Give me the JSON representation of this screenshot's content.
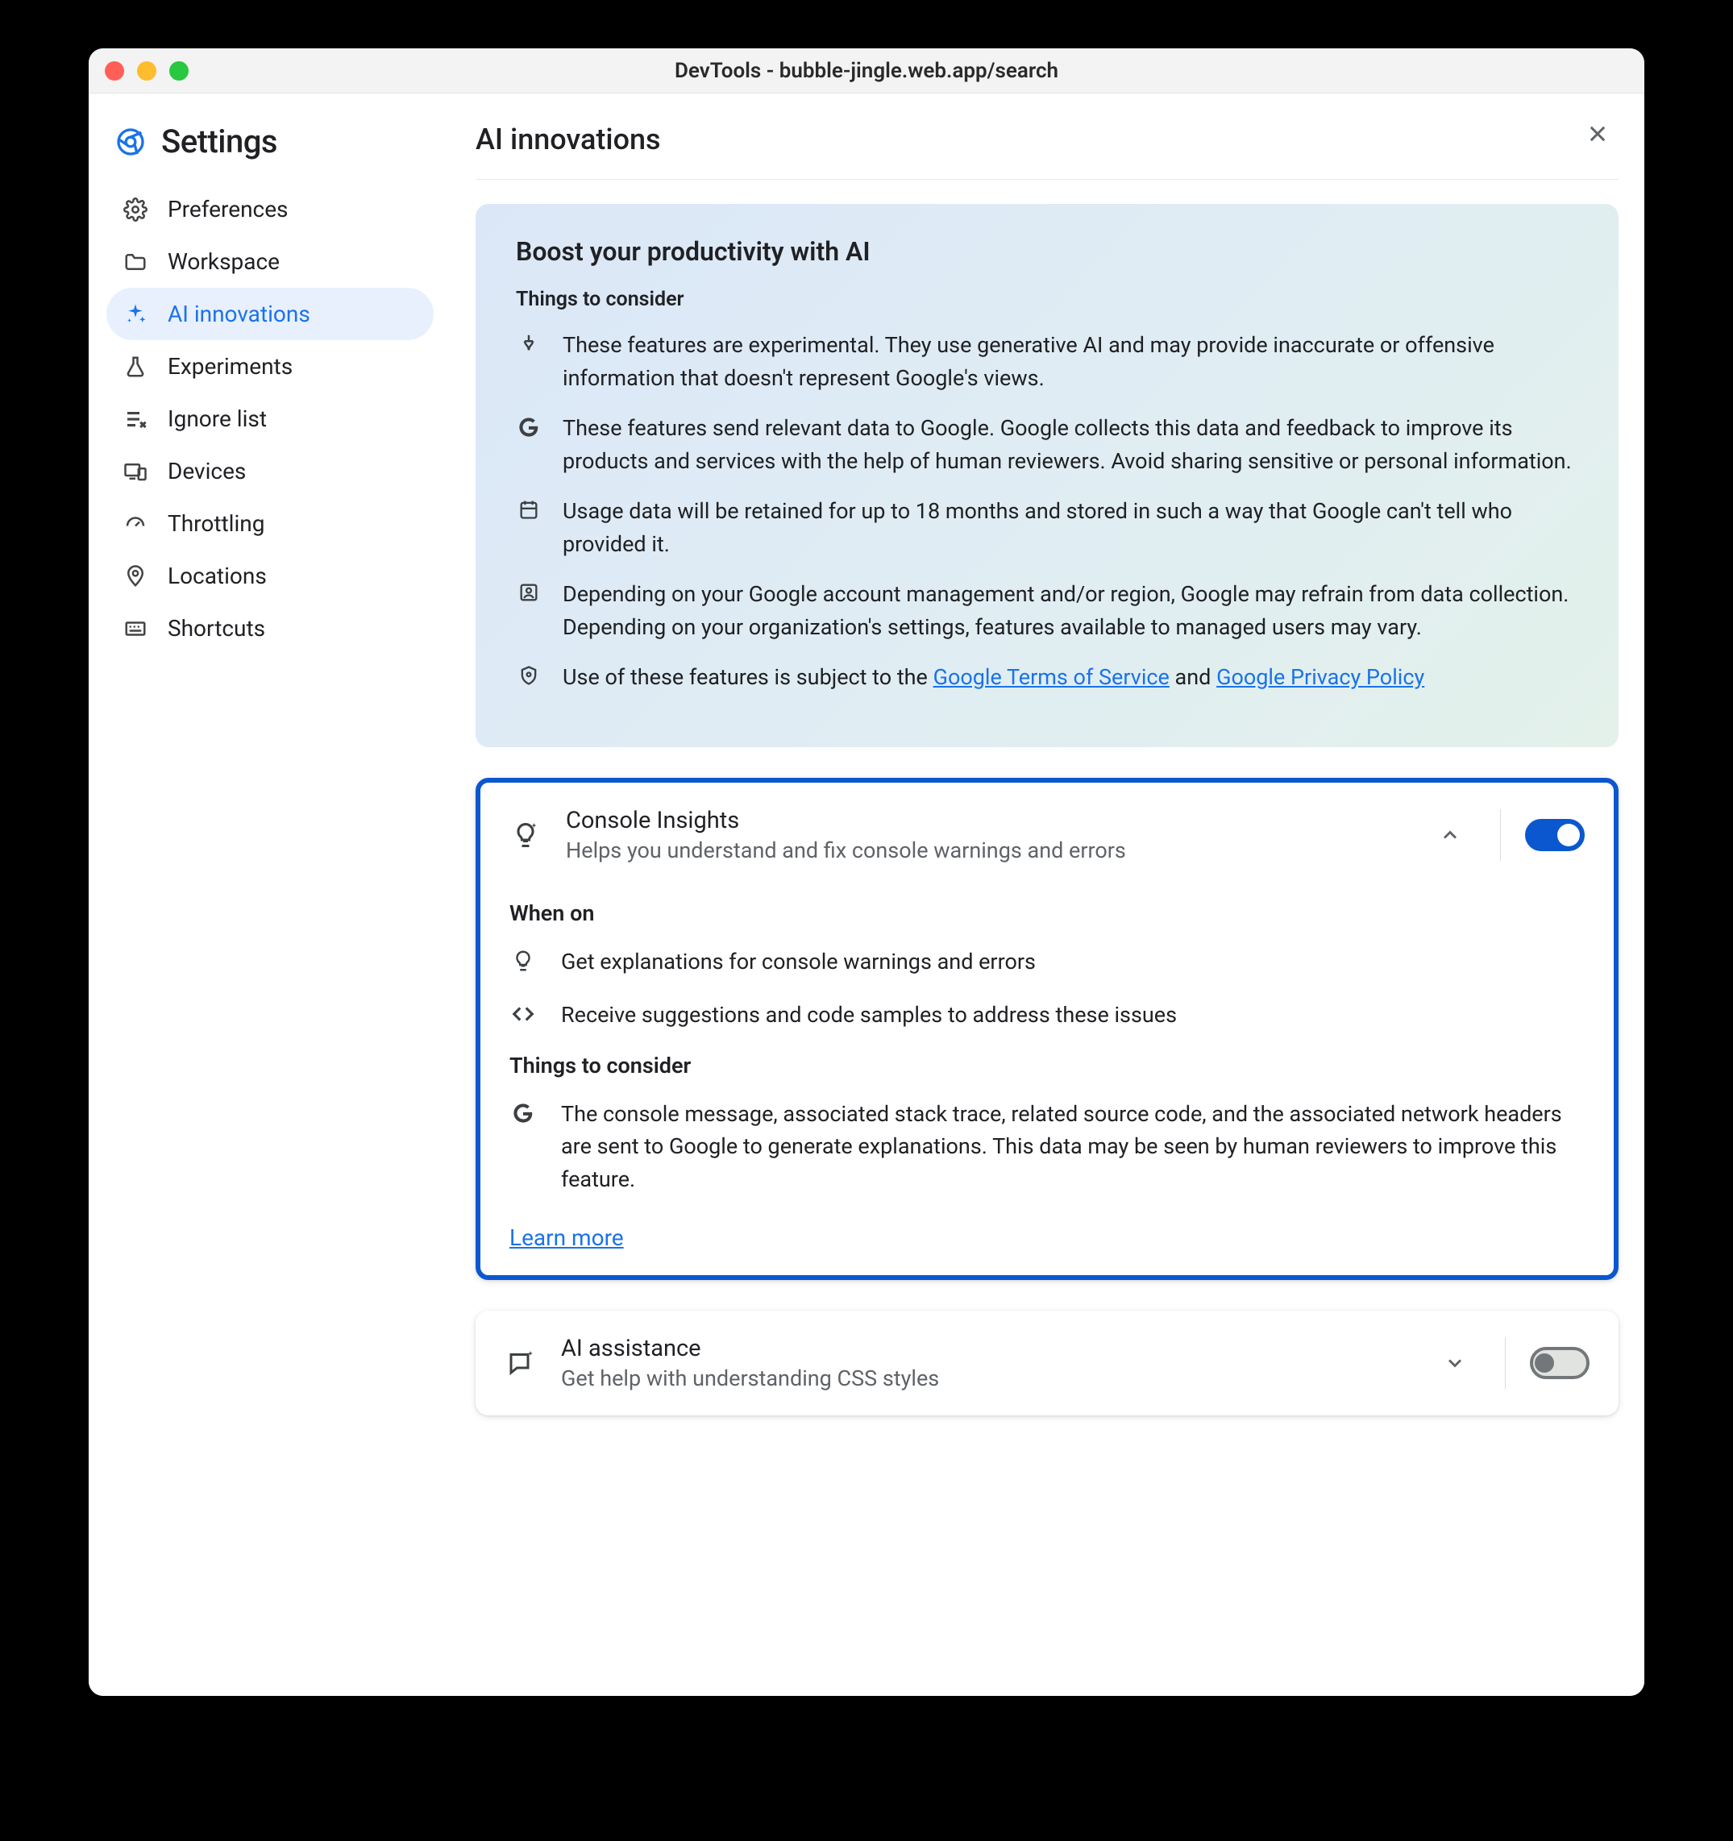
{
  "window_title": "DevTools - bubble-jingle.web.app/search",
  "settings_label": "Settings",
  "page_heading": "AI innovations",
  "sidebar": {
    "items": [
      {
        "label": "Preferences"
      },
      {
        "label": "Workspace"
      },
      {
        "label": "AI innovations"
      },
      {
        "label": "Experiments"
      },
      {
        "label": "Ignore list"
      },
      {
        "label": "Devices"
      },
      {
        "label": "Throttling"
      },
      {
        "label": "Locations"
      },
      {
        "label": "Shortcuts"
      }
    ]
  },
  "info": {
    "title": "Boost your productivity with AI",
    "subtitle": "Things to consider",
    "bullets": [
      "These features are experimental. They use generative AI and may provide inaccurate or offensive information that doesn't represent Google's views.",
      "These features send relevant data to Google. Google collects this data and feedback to improve its products and services with the help of human reviewers. Avoid sharing sensitive or personal information.",
      "Usage data will be retained for up to 18 months and stored in such a way that Google can't tell who provided it.",
      "Depending on your Google account management and/or region, Google may refrain from data collection. Depending on your organization's settings, features available to managed users may vary."
    ],
    "terms_prefix": "Use of these features is subject to the ",
    "terms_link1": "Google Terms of Service",
    "terms_mid": " and ",
    "terms_link2": "Google Privacy Policy"
  },
  "feature1": {
    "title": "Console Insights",
    "desc": "Helps you understand and fix console warnings and errors",
    "when_on_label": "When on",
    "when_on_items": [
      "Get explanations for console warnings and errors",
      "Receive suggestions and code samples to address these issues"
    ],
    "consider_label": "Things to consider",
    "consider_text": "The console message, associated stack trace, related source code, and the associated network headers are sent to Google to generate explanations. This data may be seen by human reviewers to improve this feature.",
    "learn_more": "Learn more"
  },
  "feature2": {
    "title": "AI assistance",
    "desc": "Get help with understanding CSS styles"
  }
}
